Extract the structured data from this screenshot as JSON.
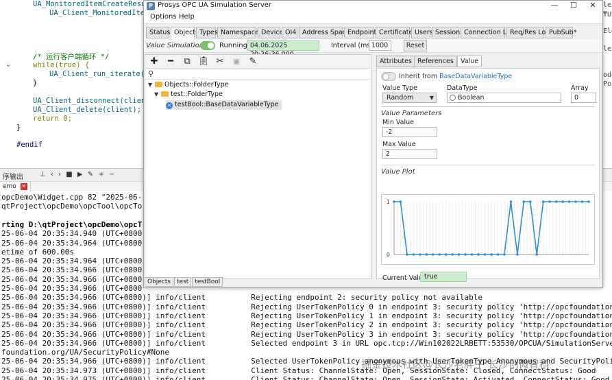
{
  "editor": {
    "lines": [
      {
        "top": 0,
        "cls": "code-fn",
        "indent": 2,
        "text": "UA_MonitoredItemCreateResul"
      },
      {
        "top": 13,
        "cls": "code-fn",
        "indent": 4,
        "text": "UA_Client_MonitoredItem"
      },
      {
        "top": 75,
        "cls": "code-cm",
        "indent": 2,
        "text": "/* 运行客户端循环 */"
      },
      {
        "top": 89,
        "cls": "code-kw",
        "indent": 2,
        "text": "while(true) {"
      },
      {
        "top": 102,
        "cls": "code-fn",
        "indent": 4,
        "text": "UA_Client_run_iterate(c"
      },
      {
        "top": 115,
        "cls": "",
        "indent": 2,
        "text": "}"
      },
      {
        "top": 141,
        "cls": "code-fn",
        "indent": 2,
        "text": "UA_Client_disconnect(client"
      },
      {
        "top": 154,
        "cls": "code-fn",
        "indent": 2,
        "text": "UA_Client_delete(client);"
      },
      {
        "top": 167,
        "cls": "code-kw",
        "indent": 2,
        "text": "return 0;"
      },
      {
        "top": 180,
        "cls": "",
        "indent": 0,
        "text": "}"
      },
      {
        "top": 205,
        "cls": "code-pp",
        "indent": 0,
        "text": "#endif"
      }
    ],
    "right_fragments": [
      {
        "top": 2,
        "text": "le ="
      },
      {
        "top": 16,
        "text": "TUS"
      },
      {
        "top": 40,
        "text": "Ele"
      },
      {
        "top": 66,
        "text": "lec"
      },
      {
        "top": 104,
        "text": "ode"
      },
      {
        "top": 117,
        "text": "Pol"
      },
      {
        "top": 347,
        "text": "tp"
      }
    ]
  },
  "output": {
    "toolbar_label": "序输出",
    "toolbar_icons": "⊥ ‹ › ■ ▶ ✎ + −",
    "tab_label": "emo",
    "lines": [
      {
        "bold": false,
        "text": "opcDemo\\Widget.cpp 82 \"2025-06-"
      },
      {
        "bold": false,
        "text": "qtProject\\opcDemo\\opcTool\\opcTo"
      },
      {
        "bold": false,
        "text": ""
      },
      {
        "bold": true,
        "text": "rting D:\\qtProject\\opcDemo\\opcT"
      },
      {
        "bold": false,
        "text": "25-06-04 20:35:34.940 (UTC+0800"
      },
      {
        "bold": false,
        "text": "25-06-04 20:35:34.964 (UTC+0800"
      },
      {
        "bold": false,
        "text": "etime of 600.00s"
      },
      {
        "bold": false,
        "text": "25-06-04 20:35:34.964 (UTC+0800"
      },
      {
        "bold": false,
        "text": "25-06-04 20:35:34.966 (UTC+0800"
      },
      {
        "bold": false,
        "text": "25-06-04 20:35:34.966 (UTC+0800"
      },
      {
        "bold": false,
        "text": "25-06-04 20:35:34.966 (UTC+0800"
      },
      {
        "bold": false,
        "text": "25-06-04 20:35:34.966 (UTC+0800)] info/client          Rejecting endpoint 2: security policy not available"
      },
      {
        "bold": false,
        "text": "25-06-04 20:35:34.966 (UTC+0800)] info/client          Rejecting UserTokenPolicy 0 in endpoint 3: security policy 'http://opcfoundation"
      },
      {
        "bold": false,
        "text": "25-06-04 20:35:34.966 (UTC+0800)] info/client          Rejecting UserTokenPolicy 1 in endpoint 3: security policy 'http://opcfoundation"
      },
      {
        "bold": false,
        "text": "25-06-04 20:35:34.966 (UTC+0800)] info/client          Rejecting UserTokenPolicy 2 in endpoint 3: security policy 'http://opcfoundation"
      },
      {
        "bold": false,
        "text": "25-06-04 20:35:34.966 (UTC+0800)] info/client          Rejecting UserTokenPolicy 3 in endpoint 3: security policy 'http://opcfoundation"
      },
      {
        "bold": false,
        "text": "25-06-04 20:35:34.966 (UTC+0800)] info/client          Selected endpoint 3 in URL opc.tcp://Win102022LRBETT:53530/OPCUA/SimulationServe"
      },
      {
        "bold": false,
        "text": "foundation.org/UA/SecurityPolicy#None"
      },
      {
        "bold": false,
        "text": "25-06-04 20:35:34.966 (UTC+0800)] info/client          Selected UserTokenPolicy anonymous with UserTokenType Anonymous and SecurityPoli"
      },
      {
        "bold": false,
        "text": "25-06-04 20:35:34.973 (UTC+0800)] info/client          Client Status: ChannelState: Open, SessionState: Closed, ConnectStatus: Good"
      },
      {
        "bold": false,
        "text": "25-06-04 20:35:34.975 (UTC+0800)] info/client          Client Status: ChannelState: Open, SessionState: Activated, ConnectStatus: Good"
      }
    ],
    "watermark": "掘金技术社区@长沙老胖子 长沙创微智科"
  },
  "window": {
    "title": "Prosys OPC UA Simulation Server",
    "menu": [
      "Options",
      "Help"
    ],
    "tabs": [
      "Status",
      "Objects",
      "Types",
      "Namespaces",
      "Device",
      "OI4",
      "Address Space",
      "Endpoints",
      "Certificates",
      "Users",
      "Sessions",
      "Connection Log",
      "Req/Res Log",
      "PubSub*"
    ],
    "active_tab": "Objects",
    "value_simulation": {
      "label": "Value Simulation",
      "toggle_on": true,
      "status": "Running",
      "datetime": "04.06.2025 20:36:36.000",
      "interval_label": "Interval (ms):",
      "interval": "1000",
      "reset": "Reset"
    },
    "tree_toolbar": [
      "add",
      "remove",
      "copy",
      "paste",
      "cut",
      "properties",
      "edit"
    ],
    "search_placeholder": "",
    "tree": [
      {
        "label": "Objects::FolderType",
        "expanded": true,
        "type": "folder"
      },
      {
        "label": "test::FolderType",
        "expanded": true,
        "type": "folder"
      },
      {
        "label": "testBool::BaseDataVariableType",
        "selected": true,
        "type": "variable"
      }
    ],
    "breadcrumb": [
      "Objects",
      "test",
      "testBool"
    ],
    "detail_tabs": [
      "Attributes",
      "References",
      "Value"
    ],
    "detail_active_tab": "Value",
    "value": {
      "inherit_prefix": "Inherit from",
      "inherit_link": "BaseDataVariableType",
      "inherit_on": false,
      "value_type_label": "Value Type",
      "value_type": "Random",
      "data_type_label": "DataType",
      "data_type": "Boolean",
      "array_size_label": "Array Size",
      "array_size": "0",
      "params_title": "Value Parameters",
      "min_label": "Min Value",
      "min_value": "-2",
      "max_label": "Max Value",
      "max_value": "2",
      "plot_title": "Value Plot",
      "current_label": "Current Value:",
      "current_value": "true"
    },
    "colors": {
      "toggle_on": "#7cc36b",
      "time_field": "#cdeccd",
      "plot_line": "#2f8fd8",
      "link": "#2a6ec8"
    }
  },
  "chart_data": {
    "type": "line",
    "title": "Value Plot",
    "ylim": [
      0,
      1
    ],
    "y_ticks": [
      "0",
      "1"
    ],
    "x": [
      0,
      1,
      2,
      3,
      4,
      5,
      6,
      7,
      8,
      9,
      10,
      11,
      12,
      13,
      14,
      15,
      16,
      17,
      18,
      19,
      20,
      21,
      22,
      23,
      24,
      25,
      26,
      27,
      28,
      29,
      30
    ],
    "series": [
      {
        "values": [
          1,
          1,
          0,
          0,
          0,
          0,
          0,
          0,
          0,
          0,
          0,
          0,
          0,
          0,
          0,
          0,
          0,
          0,
          1,
          0,
          1,
          1,
          0,
          1,
          1,
          1,
          1,
          1,
          1,
          1,
          1
        ]
      }
    ]
  }
}
